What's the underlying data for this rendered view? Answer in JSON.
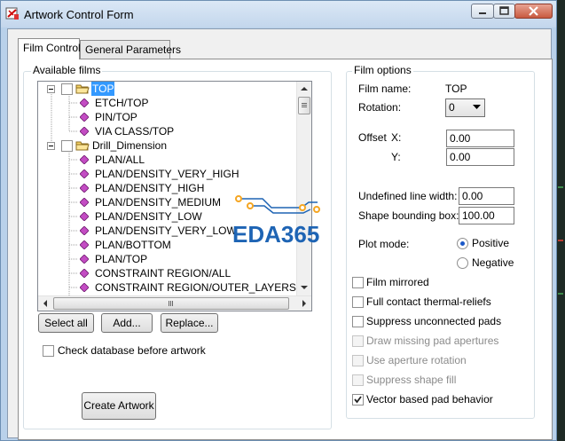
{
  "window": {
    "title": "Artwork Control Form"
  },
  "tabs": [
    {
      "label": "Film Control",
      "active": true
    },
    {
      "label": "General Parameters",
      "active": false
    }
  ],
  "films": {
    "group_label": "Available films",
    "tree": [
      {
        "label": "TOP",
        "type": "folder",
        "selected": true
      },
      {
        "label": "ETCH/TOP",
        "type": "layer"
      },
      {
        "label": "PIN/TOP",
        "type": "layer"
      },
      {
        "label": "VIA CLASS/TOP",
        "type": "layer"
      },
      {
        "label": "Drill_Dimension",
        "type": "folder",
        "selected": false
      },
      {
        "label": "PLAN/ALL",
        "type": "layer"
      },
      {
        "label": "PLAN/DENSITY_VERY_HIGH",
        "type": "layer"
      },
      {
        "label": "PLAN/DENSITY_HIGH",
        "type": "layer"
      },
      {
        "label": "PLAN/DENSITY_MEDIUM",
        "type": "layer"
      },
      {
        "label": "PLAN/DENSITY_LOW",
        "type": "layer"
      },
      {
        "label": "PLAN/DENSITY_VERY_LOW",
        "type": "layer"
      },
      {
        "label": "PLAN/BOTTOM",
        "type": "layer"
      },
      {
        "label": "PLAN/TOP",
        "type": "layer"
      },
      {
        "label": "CONSTRAINT REGION/ALL",
        "type": "layer"
      },
      {
        "label": "CONSTRAINT REGION/OUTER_LAYERS",
        "type": "layer"
      }
    ],
    "buttons": {
      "select_all": "Select all",
      "add": "Add...",
      "replace": "Replace..."
    },
    "check_database": {
      "label": "Check database before artwork",
      "checked": false
    },
    "create_artwork": "Create Artwork"
  },
  "watermark": {
    "text": "EDA365"
  },
  "options": {
    "group_label": "Film options",
    "film_name_label": "Film name:",
    "film_name_value": "TOP",
    "rotation_label": "Rotation:",
    "rotation_value": "0",
    "offset_label": "Offset",
    "offset_x_label": "X:",
    "offset_x_value": "0.00",
    "offset_y_label": "Y:",
    "offset_y_value": "0.00",
    "undefined_line_width_label": "Undefined line width:",
    "undefined_line_width_value": "0.00",
    "shape_bounding_box_label": "Shape bounding box:",
    "shape_bounding_box_value": "100.00",
    "plot_mode_label": "Plot mode:",
    "plot_modes": [
      {
        "label": "Positive",
        "selected": true
      },
      {
        "label": "Negative",
        "selected": false
      }
    ],
    "checkboxes": [
      {
        "label": "Film mirrored",
        "checked": false,
        "enabled": true
      },
      {
        "label": "Full contact thermal-reliefs",
        "checked": false,
        "enabled": true
      },
      {
        "label": "Suppress unconnected pads",
        "checked": false,
        "enabled": true
      },
      {
        "label": "Draw missing pad apertures",
        "checked": false,
        "enabled": false
      },
      {
        "label": "Use aperture rotation",
        "checked": false,
        "enabled": false
      },
      {
        "label": "Suppress shape fill",
        "checked": false,
        "enabled": false
      },
      {
        "label": "Vector based pad behavior",
        "checked": true,
        "enabled": true
      }
    ]
  },
  "colors": {
    "selection": "#3399ff",
    "watermark": "#1e64b4",
    "watermark_accent": "#f5a623",
    "title_bar": "#c3d6ec"
  },
  "icons": [
    "artwork-app-icon",
    "minimize-icon",
    "maximize-icon",
    "close-icon",
    "folder-icon",
    "layer-diamond-icon",
    "dropdown-arrow-icon",
    "scroll-up-icon",
    "scroll-down-icon",
    "scroll-left-icon",
    "scroll-right-icon"
  ]
}
